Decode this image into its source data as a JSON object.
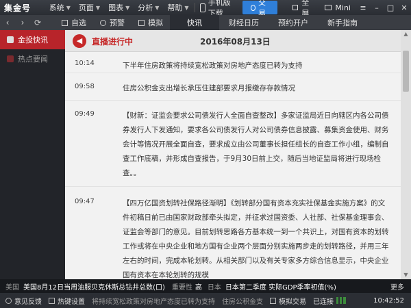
{
  "app": {
    "logo": "集金号",
    "menus": [
      "系统",
      "页面",
      "图表",
      "分析",
      "帮助"
    ],
    "mobile_download": "手机版下载",
    "trade": "交易",
    "fullscreen": "全屏",
    "mini": "Mini"
  },
  "nav": {
    "tabs": [
      {
        "label": "自选"
      },
      {
        "label": "预警"
      },
      {
        "label": "模拟"
      },
      {
        "label": "快讯"
      },
      {
        "label": "财经日历"
      },
      {
        "label": "预约开户"
      },
      {
        "label": "新手指南"
      }
    ]
  },
  "sidebar": {
    "items": [
      {
        "label": "金投快讯"
      },
      {
        "label": "热点要闻"
      }
    ]
  },
  "live": {
    "label": "直播进行中",
    "date": "2016年08月13日"
  },
  "news": [
    {
      "time": "10:14",
      "text": "下半年住房政策将持续宽松政策对房地产态度已转为支持"
    },
    {
      "time": "09:58",
      "text": "住房公积金支出增长承压住建部要求月报缴存存款情况"
    },
    {
      "time": "09:49",
      "text": "【财新：证监会要求公司债发行人全面自查整改】多家证监局近日向辖区内各公司债券发行人下发通知，要求各公司债发行人对公司债券信息披露、募集资金使用、财务会计等情况开展全面自查，要求成立由公司董事长担任组长的自查工作小组，编制自查工作底稿，并形成自查报告，于9月30日前上交，随后当地证监局将进行现场检查。。"
    },
    {
      "time": "09:47",
      "text": "【四万亿国资划转社保路径渐明】《划转部分国有资本充实社保基金实施方案》的文件初稿日前已由国家财政部牵头拟定，并征求过国资委、人社部、社保基金理事会、证监会等部门的意见。目前划转思路各方基本统一到一个共识上，对国有资本的划转工作或将在中央企业和地方国有企业两个层面分别实施两步走的划转路径，并用三年左右的时间，完成本轮划转。从相关部门以及有关专家多方综合信息显示，中央企业国有资本在本轮划转的规模"
    }
  ],
  "ticker": {
    "tag": "美国",
    "news": "美国8月12日当周油服贝克休斯总钻井总数(口)",
    "importance_label": "重要性",
    "importance_value": "高",
    "tag2": "日本",
    "news2": "日本第二季度 实际GDP季率初值(%)",
    "more": "更多"
  },
  "status": {
    "feedback": "意见反馈",
    "hotkeys": "热键设置",
    "scroll_text": "将持续宽松政策对房地产态度已转为支持",
    "scroll_text2": "住房公积金支",
    "sim_trade": "模拟交易",
    "connected": "已连接",
    "clock": "10:42:52"
  }
}
